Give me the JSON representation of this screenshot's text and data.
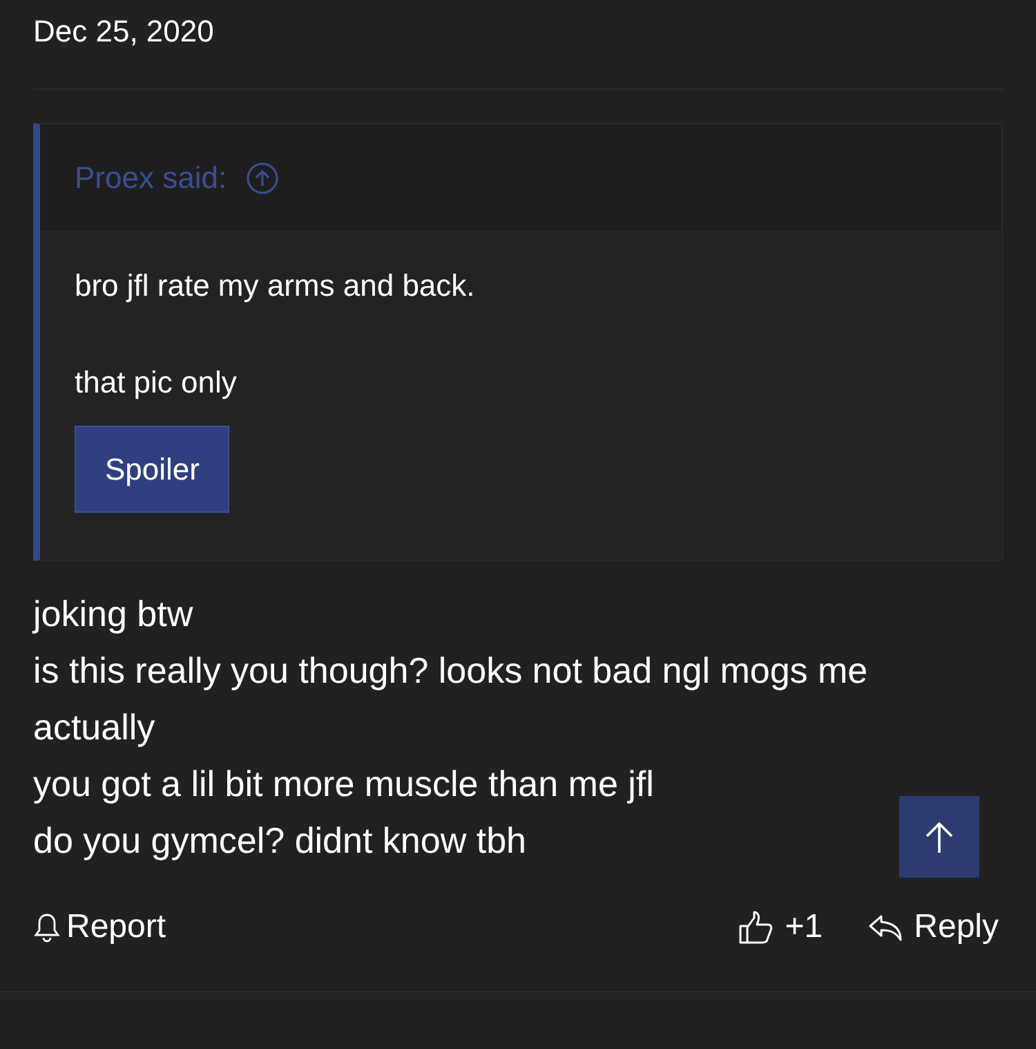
{
  "post": {
    "date": "Dec 25, 2020",
    "quote": {
      "author": "Proex said:",
      "lines": [
        "bro jfl rate my arms and back.",
        "that pic only"
      ],
      "spoiler_button": "Spoiler"
    },
    "lines": [
      "joking btw",
      "is this really you though? looks not bad ngl mogs me actually",
      "you got a lil bit more muscle than me jfl",
      "do you gymcel? didnt know tbh"
    ],
    "actions": {
      "report": "Report",
      "reaction_count": "+1",
      "reply": "Reply"
    }
  }
}
